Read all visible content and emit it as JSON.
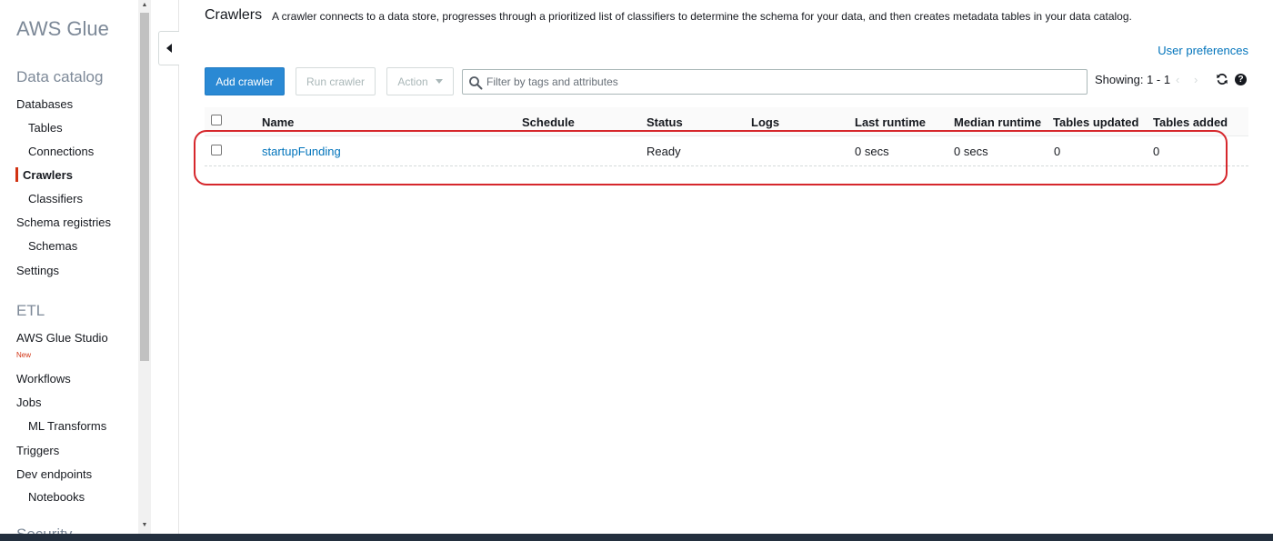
{
  "sidebar": {
    "brand": "AWS Glue",
    "data_catalog_heading": "Data catalog",
    "etl_heading": "ETL",
    "items": {
      "databases": "Databases",
      "tables": "Tables",
      "connections": "Connections",
      "crawlers": "Crawlers",
      "classifiers": "Classifiers",
      "schema_registries": "Schema registries",
      "schemas": "Schemas",
      "settings": "Settings",
      "glue_studio": "AWS Glue Studio",
      "glue_studio_badge": "New",
      "workflows": "Workflows",
      "jobs": "Jobs",
      "ml_transforms": "ML Transforms",
      "triggers": "Triggers",
      "dev_endpoints": "Dev endpoints",
      "notebooks": "Notebooks",
      "security": "Security"
    },
    "active_item": "crawlers"
  },
  "header": {
    "title": "Crawlers",
    "description": "A crawler connects to a data store, progresses through a prioritized list of classifiers to determine the schema for your data, and then creates metadata tables in your data catalog.",
    "user_preferences": "User preferences"
  },
  "toolbar": {
    "add_label": "Add crawler",
    "run_label": "Run crawler",
    "action_label": "Action",
    "search_placeholder": "Filter by tags and attributes",
    "search_value": "",
    "showing": "Showing: 1 - 1",
    "prev": "‹",
    "next": "›"
  },
  "table": {
    "columns": {
      "name": "Name",
      "schedule": "Schedule",
      "status": "Status",
      "logs": "Logs",
      "last_runtime": "Last runtime",
      "median_runtime": "Median runtime",
      "tables_updated": "Tables updated",
      "tables_added": "Tables added"
    },
    "rows": [
      {
        "name": "startupFunding",
        "schedule": "",
        "status": "Ready",
        "logs": "",
        "last_runtime": "0 secs",
        "median_runtime": "0 secs",
        "tables_updated": "0",
        "tables_added": "0",
        "selected": false
      }
    ]
  },
  "colors": {
    "primary_button": "#2a89d4",
    "link": "#0073bb",
    "active_indicator": "#d13212",
    "highlight_outline": "#d6272c"
  },
  "icons": {
    "search": "search-icon",
    "refresh": "refresh-icon",
    "help": "help-icon",
    "collapse": "chevron-left-icon"
  }
}
